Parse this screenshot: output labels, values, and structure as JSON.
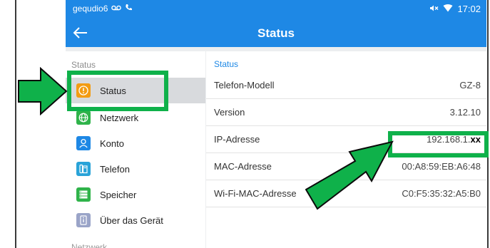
{
  "statusbar": {
    "device_name": "gequdio6",
    "time": "17:02"
  },
  "appbar": {
    "title": "Status"
  },
  "sidebar": {
    "section_label": "Status",
    "items": [
      {
        "label": "Status",
        "icon": "alert-circle-icon"
      },
      {
        "label": "Netzwerk",
        "icon": "globe-icon"
      },
      {
        "label": "Konto",
        "icon": "user-icon"
      },
      {
        "label": "Telefon",
        "icon": "phone-icon"
      },
      {
        "label": "Speicher",
        "icon": "storage-icon"
      },
      {
        "label": "Über das Gerät",
        "icon": "device-info-icon"
      }
    ],
    "next_section_label": "Netzwerk"
  },
  "content": {
    "header": "Status",
    "rows": [
      {
        "key": "Telefon-Modell",
        "value": "GZ-8"
      },
      {
        "key": "Version",
        "value": "3.12.10"
      },
      {
        "key": "IP-Adresse",
        "value": "192.168.1.",
        "value_suffix": "xx"
      },
      {
        "key": "MAC-Adresse",
        "value": "00:A8:59:EB:A6:48"
      },
      {
        "key": "Wi-Fi-MAC-Adresse",
        "value": "C0:F5:35:32:A5:B0"
      }
    ]
  },
  "colors": {
    "primary": "#1e88e5",
    "highlight": "#0fb14a",
    "status_icon": "#f39c12"
  }
}
